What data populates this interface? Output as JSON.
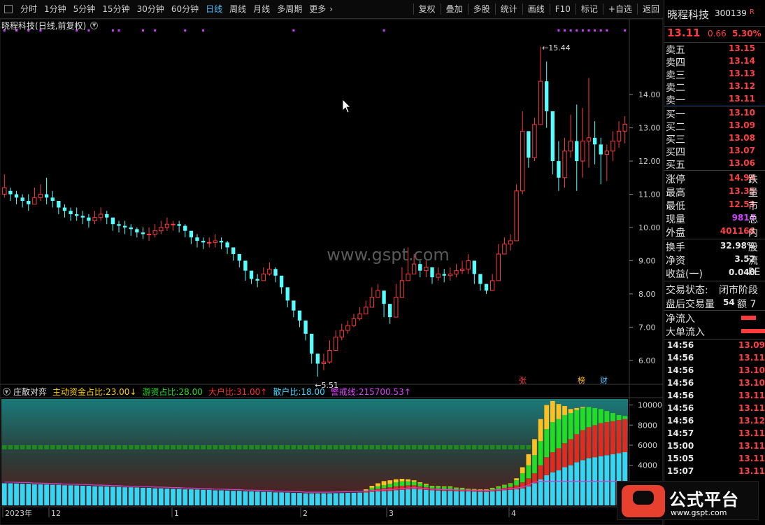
{
  "toolbar": {
    "left": [
      "分时",
      "1分钟",
      "5分钟",
      "15分钟",
      "30分钟",
      "60分钟",
      "日线",
      "周线",
      "月线",
      "多周期",
      "更多"
    ],
    "active": "日线",
    "right": [
      "复权",
      "叠加",
      "多股",
      "统计",
      "画线",
      "F10",
      "标记",
      "+自选",
      "返回"
    ]
  },
  "main": {
    "title": "晓程科技",
    "subtitle": "(日线,前复权)",
    "watermark": "www.gspt.com",
    "max_label": "15.44",
    "min_label": "5.51",
    "markers": [
      "张",
      "榜",
      "财"
    ]
  },
  "indicator": {
    "name": "庄散对弈",
    "fields": [
      {
        "label": "主动资金占比:",
        "value": "23.00",
        "arrow": "↓",
        "color": "#ffd000"
      },
      {
        "label": "游资占比:",
        "value": "28.00",
        "arrow": "",
        "color": "#20e020"
      },
      {
        "label": "大户比:",
        "value": "31.00",
        "arrow": "↑",
        "color": "#ff3030"
      },
      {
        "label": "散户比:",
        "value": "18.00",
        "arrow": "",
        "color": "#40d8ff"
      },
      {
        "label": "警戒线:",
        "value": "215700.53",
        "arrow": "↑",
        "color": "#e040ff"
      }
    ]
  },
  "x_axis": [
    "2023年",
    "12",
    "1",
    "2",
    "3",
    "4"
  ],
  "quote": {
    "name": "晓程科技",
    "code": "300139",
    "flag": "R",
    "price": "13.11",
    "change": "0.66",
    "pct": "5.30%",
    "asks": [
      {
        "label": "卖五",
        "price": "13.15"
      },
      {
        "label": "卖四",
        "price": "13.14"
      },
      {
        "label": "卖三",
        "price": "13.13"
      },
      {
        "label": "卖二",
        "price": "13.12"
      },
      {
        "label": "卖一",
        "price": "13.11"
      }
    ],
    "bids": [
      {
        "label": "买一",
        "price": "13.10"
      },
      {
        "label": "买二",
        "price": "13.09"
      },
      {
        "label": "买三",
        "price": "13.08"
      },
      {
        "label": "买四",
        "price": "13.07"
      },
      {
        "label": "买五",
        "price": "13.06"
      }
    ],
    "stats": [
      {
        "label": "涨停",
        "value": "14.94",
        "ext": "跌",
        "color": "#ff4040"
      },
      {
        "label": "最高",
        "value": "13.35",
        "ext": "量",
        "color": "#ff4040"
      },
      {
        "label": "最低",
        "value": "12.53",
        "ext": "市",
        "color": "#ff4040"
      },
      {
        "label": "现量",
        "value": "9814",
        "ext": "总",
        "color": "#d040ff"
      },
      {
        "label": "外盘",
        "value": "401168",
        "ext": "内",
        "color": "#ff4040"
      }
    ],
    "stats2": [
      {
        "label": "换手",
        "value": "32.98%",
        "ext": "股"
      },
      {
        "label": "净资",
        "value": "3.52",
        "ext": "流"
      },
      {
        "label": "收益(一)",
        "value": "0.040",
        "ext": "PE"
      }
    ],
    "trade_state_label": "交易状态:",
    "trade_state_value": "闭市阶段",
    "after_label": "盘后交易量",
    "after_value": "54",
    "after_ext": "额 7",
    "flow_label": "净流入",
    "big_flow_label": "大单流入",
    "flow_fraction": 0.3,
    "big_flow_fraction": 1.0,
    "ticks": [
      {
        "time": "14:56",
        "price": "13.09"
      },
      {
        "time": "14:56",
        "price": "13.11"
      },
      {
        "time": "14:56",
        "price": "13.10"
      },
      {
        "time": "14:56",
        "price": "13.10"
      },
      {
        "time": "14:56",
        "price": "13.11"
      },
      {
        "time": "14:56",
        "price": "13.11"
      },
      {
        "time": "14:56",
        "price": "13.12"
      },
      {
        "time": "14:57",
        "price": "13.11"
      },
      {
        "time": "15:00",
        "price": "13.11"
      },
      {
        "time": "15:05",
        "price": "13.11"
      },
      {
        "time": "15:07",
        "price": "13.11"
      }
    ]
  },
  "logo": {
    "brand": "公式平台",
    "url": "www.gspt.com"
  },
  "chart_data": [
    {
      "type": "candlestick",
      "title": "晓程科技 (日线,前复权)",
      "y_ticks": [
        6.0,
        7.0,
        8.0,
        9.0,
        10.0,
        11.0,
        12.0,
        13.0,
        14.0
      ],
      "ylim": [
        5.3,
        15.9
      ],
      "max": 15.44,
      "min": 5.51,
      "x_ticks": [
        "2023年",
        "12",
        "1",
        "2",
        "3",
        "4"
      ],
      "closes": [
        11.2,
        11.0,
        10.9,
        10.8,
        10.7,
        10.9,
        11.0,
        10.9,
        10.8,
        10.6,
        10.5,
        10.4,
        10.35,
        10.3,
        10.2,
        10.3,
        10.4,
        10.3,
        10.1,
        10.05,
        10.0,
        9.95,
        9.85,
        9.8,
        9.8,
        9.9,
        10.0,
        10.1,
        10.1,
        10.05,
        9.9,
        9.7,
        9.6,
        9.55,
        9.55,
        9.6,
        9.55,
        9.4,
        9.2,
        9.0,
        8.7,
        8.45,
        8.4,
        8.6,
        8.75,
        8.55,
        8.2,
        7.8,
        7.5,
        7.2,
        6.8,
        6.2,
        5.9,
        5.95,
        6.3,
        6.7,
        6.9,
        7.05,
        7.25,
        7.4,
        7.6,
        7.9,
        8.1,
        7.7,
        7.3,
        7.9,
        8.4,
        8.6,
        8.9,
        8.7,
        8.8,
        8.5,
        8.6,
        8.55,
        8.6,
        8.7,
        8.75,
        9.0,
        8.6,
        8.3,
        8.1,
        8.4,
        9.2,
        9.5,
        9.6,
        11.1,
        12.9,
        12.1,
        13.1,
        14.4,
        13.5,
        12.0,
        11.5,
        12.3,
        12.6,
        12.0,
        12.6,
        12.7,
        12.5,
        12.2,
        12.3,
        12.6,
        12.9,
        13.11
      ],
      "highs": [
        11.6,
        11.2,
        11.1,
        11.0,
        11.0,
        11.2,
        11.3,
        11.5,
        11.1,
        10.8,
        10.7,
        10.6,
        10.6,
        10.5,
        10.4,
        10.5,
        10.6,
        10.5,
        10.3,
        10.2,
        10.2,
        10.1,
        10.0,
        10.0,
        10.0,
        10.1,
        10.2,
        10.3,
        10.2,
        10.2,
        10.1,
        9.9,
        9.8,
        9.7,
        9.7,
        9.8,
        9.7,
        9.6,
        9.4,
        9.2,
        8.9,
        8.6,
        8.6,
        8.8,
        8.95,
        8.8,
        8.5,
        8.1,
        7.7,
        7.4,
        7.0,
        6.5,
        6.1,
        6.2,
        6.6,
        6.9,
        7.1,
        7.2,
        7.4,
        7.6,
        7.8,
        8.2,
        8.3,
        8.0,
        7.6,
        8.3,
        8.8,
        9.4,
        9.2,
        9.0,
        9.0,
        8.8,
        8.8,
        8.75,
        8.8,
        8.9,
        9.0,
        9.2,
        8.9,
        8.5,
        8.3,
        8.6,
        9.5,
        9.7,
        9.8,
        11.3,
        13.5,
        12.8,
        13.3,
        15.44,
        15.0,
        13.3,
        12.6,
        12.7,
        13.4,
        13.7,
        13.6,
        14.5,
        13.2,
        12.7,
        12.5,
        12.9,
        13.2,
        13.35
      ],
      "lows": [
        10.9,
        10.8,
        10.7,
        10.6,
        10.5,
        10.7,
        10.8,
        10.7,
        10.6,
        10.4,
        10.3,
        10.2,
        10.2,
        10.1,
        10.0,
        10.1,
        10.2,
        10.1,
        9.9,
        9.85,
        9.8,
        9.75,
        9.7,
        9.65,
        9.6,
        9.7,
        9.8,
        9.9,
        9.9,
        9.85,
        9.7,
        9.5,
        9.4,
        9.35,
        9.4,
        9.4,
        9.35,
        9.2,
        9.0,
        8.8,
        8.4,
        8.3,
        8.2,
        8.4,
        8.55,
        8.35,
        8.0,
        7.6,
        7.3,
        7.0,
        6.6,
        5.9,
        5.51,
        5.7,
        5.9,
        6.3,
        6.6,
        6.8,
        7.0,
        7.2,
        7.4,
        7.7,
        7.9,
        7.3,
        7.1,
        7.6,
        8.1,
        8.4,
        8.6,
        8.5,
        8.5,
        8.3,
        8.4,
        8.35,
        8.4,
        8.5,
        8.6,
        8.6,
        8.3,
        8.1,
        8.0,
        8.1,
        8.9,
        9.3,
        9.3,
        9.6,
        11.0,
        11.8,
        12.0,
        13.4,
        13.0,
        11.6,
        11.1,
        11.2,
        12.1,
        11.1,
        11.5,
        11.8,
        11.9,
        11.3,
        11.4,
        12.0,
        12.4,
        12.53
      ],
      "opens": [
        11.0,
        11.1,
        11.0,
        10.9,
        10.8,
        10.7,
        10.9,
        11.0,
        10.9,
        10.8,
        10.6,
        10.5,
        10.4,
        10.35,
        10.3,
        10.2,
        10.3,
        10.4,
        10.3,
        10.1,
        10.05,
        10.0,
        9.95,
        9.85,
        9.8,
        9.8,
        9.9,
        10.0,
        10.1,
        10.1,
        10.05,
        9.9,
        9.7,
        9.6,
        9.55,
        9.55,
        9.6,
        9.55,
        9.4,
        9.2,
        9.0,
        8.7,
        8.45,
        8.4,
        8.6,
        8.75,
        8.55,
        8.2,
        7.8,
        7.5,
        7.2,
        6.8,
        6.2,
        5.9,
        5.95,
        6.3,
        6.7,
        6.9,
        7.05,
        7.25,
        7.4,
        7.6,
        7.9,
        8.1,
        7.7,
        7.3,
        7.9,
        8.4,
        8.6,
        8.9,
        8.7,
        8.8,
        8.5,
        8.6,
        8.55,
        8.6,
        8.7,
        8.75,
        9.0,
        8.6,
        8.3,
        8.1,
        8.4,
        9.2,
        9.5,
        9.6,
        11.1,
        12.9,
        12.1,
        13.1,
        14.4,
        13.5,
        12.0,
        11.5,
        12.3,
        12.6,
        12.0,
        12.6,
        12.7,
        12.5,
        12.2,
        12.3,
        12.6,
        12.9
      ]
    },
    {
      "type": "bar",
      "title": "庄散对弈",
      "y_ticks": [
        4000,
        6000,
        8000,
        10000
      ],
      "ylim": [
        0,
        10600
      ],
      "legend": [
        "主动资金占比",
        "游资占比",
        "大户比",
        "散户比",
        "警戒线"
      ],
      "colors": {
        "散户比": "#33d6f5",
        "大户比": "#e02b20",
        "游资占比": "#22dd22",
        "主动资金占比": "#ffc020",
        "base_green": "#1e8a1e",
        "警戒线": "#d040d0"
      },
      "cyan_values": [
        2200,
        2200,
        2180,
        2150,
        2150,
        2100,
        2100,
        2080,
        2050,
        2050,
        2000,
        2000,
        1980,
        1950,
        1950,
        1900,
        1900,
        1880,
        1850,
        1850,
        1800,
        1800,
        1780,
        1750,
        1750,
        1700,
        1700,
        1680,
        1650,
        1650,
        1600,
        1600,
        1580,
        1550,
        1550,
        1500,
        1500,
        1480,
        1450,
        1450,
        1400,
        1400,
        1380,
        1350,
        1350,
        1300,
        1300,
        1280,
        1250,
        1250,
        1200,
        1200,
        1200,
        1200,
        1200,
        1220,
        1230,
        1250,
        1260,
        1280,
        1300,
        1350,
        1400,
        1420,
        1450,
        1500,
        1550,
        1600,
        1650,
        1600,
        1550,
        1500,
        1480,
        1450,
        1450,
        1420,
        1400,
        1400,
        1380,
        1350,
        1350,
        1400,
        1450,
        1500,
        1550,
        1600,
        1700,
        1900,
        2200,
        2600,
        3000,
        3300,
        3500,
        3800,
        4000,
        4300,
        4500,
        4700,
        4800,
        4900,
        5000,
        5100,
        5200,
        5300
      ],
      "red_values": [
        0,
        0,
        0,
        0,
        0,
        0,
        0,
        0,
        0,
        0,
        0,
        0,
        0,
        0,
        0,
        0,
        0,
        0,
        0,
        0,
        0,
        0,
        0,
        0,
        0,
        0,
        0,
        0,
        0,
        0,
        0,
        0,
        0,
        0,
        0,
        0,
        0,
        0,
        0,
        0,
        0,
        0,
        0,
        0,
        0,
        0,
        0,
        0,
        0,
        0,
        0,
        0,
        0,
        0,
        0,
        0,
        0,
        0,
        0,
        0,
        100,
        200,
        250,
        300,
        350,
        400,
        400,
        400,
        350,
        300,
        250,
        200,
        200,
        200,
        200,
        150,
        150,
        100,
        100,
        100,
        100,
        150,
        200,
        250,
        300,
        400,
        600,
        800,
        1000,
        1400,
        1800,
        2000,
        2200,
        2400,
        2600,
        2800,
        3000,
        3100,
        3200,
        3300,
        3300,
        3300,
        3300,
        3300
      ],
      "green_values": [
        0,
        0,
        0,
        0,
        0,
        0,
        0,
        0,
        0,
        0,
        0,
        0,
        0,
        0,
        0,
        0,
        0,
        0,
        0,
        0,
        0,
        0,
        0,
        0,
        0,
        0,
        0,
        0,
        0,
        0,
        0,
        0,
        0,
        0,
        0,
        0,
        0,
        0,
        0,
        0,
        0,
        0,
        0,
        0,
        0,
        0,
        0,
        0,
        0,
        0,
        0,
        0,
        0,
        0,
        0,
        0,
        0,
        0,
        0,
        0,
        100,
        200,
        250,
        300,
        350,
        400,
        450,
        400,
        350,
        300,
        250,
        200,
        200,
        200,
        200,
        150,
        150,
        100,
        100,
        100,
        100,
        150,
        200,
        250,
        300,
        500,
        900,
        1300,
        1800,
        2400,
        2800,
        3000,
        2900,
        2800,
        2600,
        2400,
        2200,
        2000,
        1700,
        1400,
        1100,
        800,
        500,
        300
      ],
      "yellow_values": [
        0,
        0,
        0,
        0,
        0,
        0,
        0,
        0,
        0,
        0,
        0,
        0,
        0,
        0,
        0,
        0,
        0,
        0,
        0,
        0,
        0,
        0,
        0,
        0,
        0,
        0,
        0,
        0,
        0,
        0,
        0,
        0,
        0,
        0,
        0,
        0,
        0,
        0,
        0,
        0,
        0,
        0,
        0,
        0,
        0,
        0,
        0,
        0,
        0,
        0,
        0,
        0,
        0,
        0,
        0,
        0,
        0,
        0,
        0,
        0,
        100,
        200,
        300,
        400,
        350,
        300,
        250,
        200,
        150,
        100,
        100,
        50,
        50,
        50,
        50,
        50,
        50,
        50,
        50,
        50,
        50,
        50,
        50,
        50,
        50,
        200,
        600,
        1100,
        1600,
        2200,
        2400,
        2100,
        1500,
        900,
        400,
        200,
        100,
        0,
        0,
        0,
        0,
        0,
        0,
        0
      ],
      "base_green_level": 6000
    }
  ]
}
